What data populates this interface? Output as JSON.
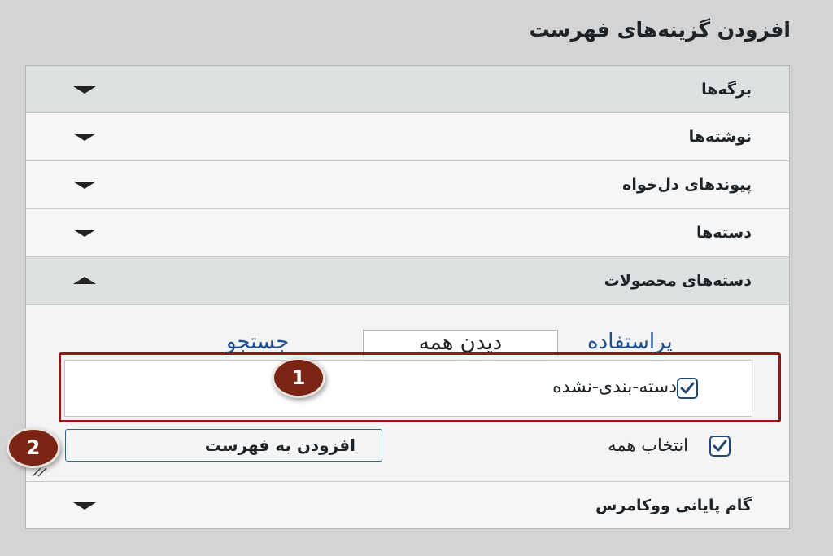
{
  "title": "افزودن گزینه‌های فهرست",
  "sections": [
    {
      "label": "برگه‌ها",
      "state": "collapsed"
    },
    {
      "label": "نوشته‌ها",
      "state": "collapsed"
    },
    {
      "label": "پیوندهای دل‌خواه",
      "state": "collapsed"
    },
    {
      "label": "دسته‌ها",
      "state": "collapsed"
    },
    {
      "label": "دسته‌های محصولات",
      "state": "expanded"
    },
    {
      "label": "گام پایانی ووکامرس",
      "state": "collapsed"
    }
  ],
  "tabs": {
    "most_used": "پراستفاده",
    "view_all": "دیدن همه",
    "search": "جستجو"
  },
  "items": [
    {
      "label": "دسته-بندی-نشده",
      "checked": true
    }
  ],
  "select_all_label": "انتخاب همه",
  "add_to_menu_label": "افزودن به فهرست",
  "badges": [
    "1",
    "2"
  ],
  "colors": {
    "background": "#d4d4d4",
    "highlight_frame": "#8f1a1a",
    "badge": "#7a2414",
    "checkbox": "#23486e",
    "link": "#1f4f8f"
  },
  "icons": {
    "collapse": "chevron-down-icon",
    "expand": "chevron-up-icon",
    "check": "checkmark-icon"
  }
}
